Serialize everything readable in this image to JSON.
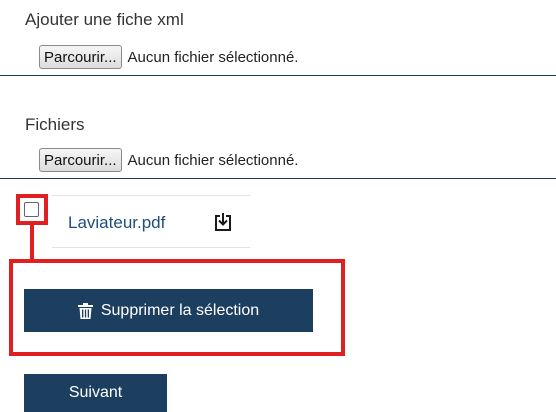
{
  "xml_section": {
    "label": "Ajouter une fiche xml",
    "browse_label": "Parcourir...",
    "status": "Aucun fichier sélectionné."
  },
  "files_section": {
    "label": "Fichiers",
    "browse_label": "Parcourir...",
    "status": "Aucun fichier sélectionné."
  },
  "uploaded_files": [
    {
      "name": "Laviateur.pdf",
      "checked": false,
      "icon": "download-icon"
    }
  ],
  "actions": {
    "delete_selection": "Supprimer la sélection",
    "delete_icon": "trash-icon",
    "next": "Suivant"
  },
  "colors": {
    "primary_button": "#1c3f5f",
    "link": "#1e4e7e",
    "highlight": "#e02020"
  }
}
